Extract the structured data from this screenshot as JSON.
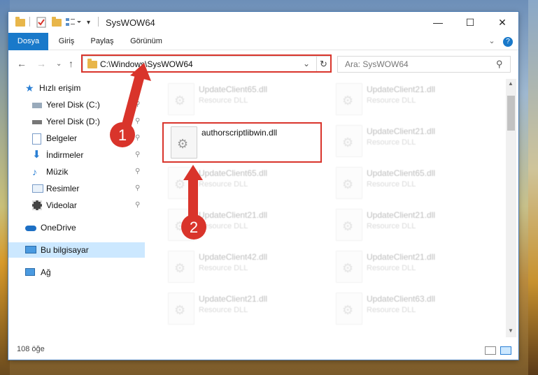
{
  "window": {
    "title": "SysWOW64",
    "min_glyph": "—",
    "max_glyph": "☐",
    "close_glyph": "✕"
  },
  "ribbon": {
    "tabs": [
      "Dosya",
      "Giriş",
      "Paylaş",
      "Görünüm"
    ],
    "expand_glyph": "⌄",
    "help_glyph": "?"
  },
  "nav": {
    "back": "←",
    "forward": "→",
    "recent": "⌄",
    "up": "↑"
  },
  "address": {
    "path": "C:\\Windows\\SysWOW64",
    "dropdown_glyph": "⌄",
    "refresh_glyph": "↻"
  },
  "search": {
    "placeholder": "Ara: SysWOW64",
    "icon_glyph": "⚲"
  },
  "sidebar": {
    "items": [
      {
        "label": "Hızlı erişim",
        "icon": "star-icon",
        "pinned": false
      },
      {
        "label": "Yerel Disk (C:)",
        "icon": "drive-icon",
        "pinned": true
      },
      {
        "label": "Yerel Disk (D:)",
        "icon": "drive-icon",
        "pinned": true
      },
      {
        "label": "Belgeler",
        "icon": "documents-icon",
        "pinned": true
      },
      {
        "label": "İndirmeler",
        "icon": "downloads-icon",
        "pinned": true
      },
      {
        "label": "Müzik",
        "icon": "music-icon",
        "pinned": true
      },
      {
        "label": "Resimler",
        "icon": "pictures-icon",
        "pinned": true
      },
      {
        "label": "Videolar",
        "icon": "videos-icon",
        "pinned": true
      },
      {
        "label": "OneDrive",
        "icon": "cloud-icon",
        "pinned": false
      },
      {
        "label": "Bu bilgisayar",
        "icon": "computer-icon",
        "pinned": false
      },
      {
        "label": "Ağ",
        "icon": "network-icon",
        "pinned": false
      }
    ],
    "pin_glyph": "📌"
  },
  "files": [
    {
      "name": "UpdateClient65.dll",
      "type": "Resource DLL",
      "blurred": true
    },
    {
      "name": "UpdateClient21.dll",
      "type": "Resource DLL",
      "blurred": true
    },
    {
      "name": "authorscriptlibwin.dll",
      "type": "",
      "blurred": false
    },
    {
      "name": "UpdateClient21.dll",
      "type": "Resource DLL",
      "blurred": true
    },
    {
      "name": "UpdateClient65.dll",
      "type": "Resource DLL",
      "blurred": true
    },
    {
      "name": "UpdateClient65.dll",
      "type": "Resource DLL",
      "blurred": true
    },
    {
      "name": "UpdateClient21.dll",
      "type": "Resource DLL",
      "blurred": true
    },
    {
      "name": "UpdateClient21.dll",
      "type": "Resource DLL",
      "blurred": true
    },
    {
      "name": "UpdateClient42.dll",
      "type": "Resource DLL",
      "blurred": true
    },
    {
      "name": "UpdateClient21.dll",
      "type": "Resource DLL",
      "blurred": true
    },
    {
      "name": "UpdateClient21.dll",
      "type": "Resource DLL",
      "blurred": true
    },
    {
      "name": "UpdateClient63.dll",
      "type": "Resource DLL",
      "blurred": true
    }
  ],
  "status": {
    "item_count": "108 öğe"
  },
  "annotations": {
    "step1": "1",
    "step2": "2",
    "color": "#d9342b"
  }
}
